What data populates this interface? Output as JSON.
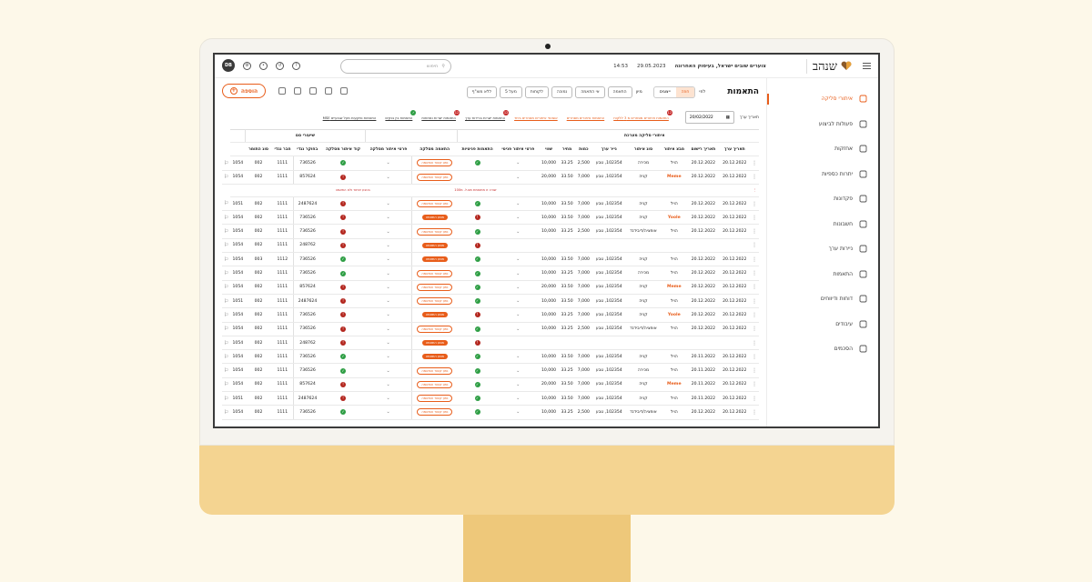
{
  "app": {
    "logo_text": "שנהב",
    "company": "צוערים שובים ישראל, בעיסוק האחרונה",
    "date": "29.05.2023",
    "time": "14:53",
    "search_placeholder": "חיפוש",
    "avatar": "DB"
  },
  "sidebar": [
    {
      "label": "איתורי סליקה",
      "active": true,
      "icon": "receipt-icon"
    },
    {
      "label": "פעולות לביצוע",
      "icon": "tasks-icon"
    },
    {
      "label": "אחזקות",
      "icon": "holdings-icon"
    },
    {
      "label": "יתרות כספיות",
      "icon": "scale-icon"
    },
    {
      "label": "פקדונות",
      "icon": "deposit-icon"
    },
    {
      "label": "חשבונות",
      "icon": "user-icon"
    },
    {
      "label": "ניירות ערך",
      "icon": "star-icon"
    },
    {
      "label": "התאמות",
      "icon": "match-icon"
    },
    {
      "label": "דוחות ודיווחים",
      "icon": "report-icon"
    },
    {
      "label": "עיבודים",
      "icon": "process-icon"
    },
    {
      "label": "הסכמים",
      "icon": "agreement-icon"
    }
  ],
  "page": {
    "title": "התאמות",
    "view_label": "לפי",
    "seg": [
      "חוזה",
      "ייצוגים"
    ],
    "sort_label": "מיון",
    "chips": [
      "התאמה",
      "אי התאמה",
      "נמוכה",
      "לקוחות",
      "מעל 5",
      "ללא מוצ\"ף"
    ],
    "add_label": "הוספה",
    "date_label": "תאריך ערך",
    "date_value": "20/02/2022"
  },
  "filters": [
    {
      "label": "התאמות איתורים מסחרים מ 3 ללקוח",
      "orange": true,
      "badge": "12",
      "badge_color": "red"
    },
    {
      "label": "התאמות איתורים מסחרים",
      "orange": true
    },
    {
      "label": "אשכנזי איתורים מסחרים ביחד",
      "orange": true
    },
    {
      "label": "התאמות ישרות בניירות ערך",
      "badge": "12",
      "badge_color": "red"
    },
    {
      "label": "התאמות ישרות נפתחות",
      "badge": "12",
      "badge_color": "red"
    },
    {
      "label": "התאמות בין בנקים",
      "badge": "✓",
      "badge_color": "green"
    },
    {
      "label": "התאמות נתקעות מעל שבועיים MSE"
    }
  ],
  "table": {
    "group_a": "איתורי סליקה מערכת",
    "group_b": "שיעורי סם",
    "headers": [
      "תאריך ערך",
      "תאריך רישום",
      "מבצ איתור",
      "סוג איתור",
      "נייר ערך",
      "כמות",
      "מחיר",
      "שווי",
      "פרטי איתור פניטי",
      "התאמות פניטיות",
      "התאמה מסלקה",
      "פרטי איתור מסלקה",
      "קוד איתור מסלקה",
      "בחוקר נגדי",
      "חבר נגדי",
      "סוג התומר"
    ],
    "rows": [
      {
        "d1": "20.12.2022",
        "d2": "20.12.2022",
        "src": "הויל",
        "type": "מכירה",
        "sec": "102354, טבע",
        "qty": "2,500",
        "price": "33.25",
        "val": "10,000",
        "s1": "ok",
        "s2": "ok",
        "tag": "נתון קשור והתאמה",
        "tagt": "out",
        "code": "736526",
        "c1": "1111",
        "c2": "002",
        "c3": "1054"
      },
      {
        "d1": "20.12.2022",
        "d2": "20.12.2022",
        "src": "Meme",
        "type": "קניה",
        "sec": "102354, טבע",
        "qty": "7,000",
        "price": "33.50",
        "val": "20,000",
        "s1": "",
        "s2": "bad",
        "tag": "נתון קשור והתאמה",
        "tagt": "out",
        "code": "857624",
        "c1": "1111",
        "c2": "002",
        "c3": "1054"
      },
      {
        "err": "שורה זו מתואמת מס.ל. מ100",
        "err2": "בטבע איתור ולא התאמה"
      },
      {
        "d1": "20.12.2022",
        "d2": "20.12.2022",
        "src": "הויל",
        "type": "קניה",
        "sec": "102354, טבע",
        "qty": "7,000",
        "price": "33.50",
        "val": "10,000",
        "s1": "ok",
        "s2": "bad",
        "tag": "נתון קשור והתאמה",
        "tagt": "out",
        "code": "2487624",
        "c1": "1111",
        "c2": "002",
        "c3": "1051"
      },
      {
        "d1": "20.12.2022",
        "d2": "20.12.2022",
        "src": "Yoole",
        "type": "קניה",
        "sec": "102354, טבע",
        "qty": "7,000",
        "price": "33.50",
        "val": "10,000",
        "s1": "bad",
        "s2": "bad",
        "tag": "מנוע התאמה",
        "tagt": "fill",
        "code": "736526",
        "c1": "1111",
        "c2": "002",
        "c3": "1054"
      },
      {
        "d1": "20.12.2022",
        "d2": "20.12.2022",
        "src": "הויל",
        "type": "אופציה/דיבידנד",
        "sec": "102354, טבע",
        "qty": "2,500",
        "price": "33.25",
        "val": "10,000",
        "s1": "ok",
        "s2": "bad",
        "tag": "נתון קשור והתאמה",
        "tagt": "out",
        "code": "736526",
        "c1": "1111",
        "c2": "002",
        "c3": "1054"
      },
      {
        "d1": "",
        "d2": "",
        "src": "",
        "type": "",
        "sec": "",
        "qty": "",
        "price": "",
        "val": "",
        "s1": "bad",
        "s2": "bad",
        "tag": "מנוע התאמה",
        "tagt": "fill",
        "code": "248762",
        "c1": "1111",
        "c2": "002",
        "c3": "1054"
      },
      {
        "d1": "20.12.2022",
        "d2": "20.12.2022",
        "src": "הויל",
        "type": "קניה",
        "sec": "102354, טבע",
        "qty": "7,000",
        "price": "33.50",
        "val": "10,000",
        "s1": "ok",
        "s2": "ok",
        "tag": "מנוע התאמה",
        "tagt": "fill",
        "code": "736526",
        "c1": "1112",
        "c2": "003",
        "c3": "1054"
      },
      {
        "d1": "20.12.2022",
        "d2": "20.12.2022",
        "src": "הויל",
        "type": "מכירה",
        "sec": "102354, טבע",
        "qty": "7,000",
        "price": "33.25",
        "val": "10,000",
        "s1": "ok",
        "s2": "ok",
        "tag": "נתון קשור והתאמה",
        "tagt": "out",
        "code": "736526",
        "c1": "1111",
        "c2": "002",
        "c3": "1054"
      },
      {
        "d1": "20.12.2022",
        "d2": "20.12.2022",
        "src": "Meme",
        "type": "קניה",
        "sec": "102354, טבע",
        "qty": "7,000",
        "price": "33.50",
        "val": "20,000",
        "s1": "ok",
        "s2": "bad",
        "tag": "נתון קשור והתאמה",
        "tagt": "out",
        "code": "857624",
        "c1": "1111",
        "c2": "002",
        "c3": "1054"
      },
      {
        "d1": "20.12.2022",
        "d2": "20.12.2022",
        "src": "הויל",
        "type": "קניה",
        "sec": "102354, טבע",
        "qty": "7,000",
        "price": "33.50",
        "val": "10,000",
        "s1": "ok",
        "s2": "bad",
        "tag": "נתון קשור והתאמה",
        "tagt": "out",
        "code": "2487624",
        "c1": "1111",
        "c2": "002",
        "c3": "1051"
      },
      {
        "d1": "20.12.2022",
        "d2": "20.12.2022",
        "src": "Yoole",
        "type": "קניה",
        "sec": "102354, טבע",
        "qty": "7,000",
        "price": "33.25",
        "val": "10,000",
        "s1": "bad",
        "s2": "bad",
        "tag": "מנוע התאמה",
        "tagt": "fill",
        "code": "736526",
        "c1": "1111",
        "c2": "002",
        "c3": "1054"
      },
      {
        "d1": "20.12.2022",
        "d2": "20.12.2022",
        "src": "הויל",
        "type": "אופציה/דיבידנד",
        "sec": "102354, טבע",
        "qty": "2,500",
        "price": "33.25",
        "val": "10,000",
        "s1": "ok",
        "s2": "bad",
        "tag": "נתון קשור והתאמה",
        "tagt": "out",
        "code": "736526",
        "c1": "1111",
        "c2": "002",
        "c3": "1054"
      },
      {
        "d1": "",
        "d2": "",
        "src": "",
        "type": "",
        "sec": "",
        "qty": "",
        "price": "",
        "val": "",
        "s1": "bad",
        "s2": "bad",
        "tag": "מנוע התאמה",
        "tagt": "fill",
        "code": "248762",
        "c1": "1111",
        "c2": "002",
        "c3": "1054"
      },
      {
        "d1": "20.12.2022",
        "d2": "20.11.2022",
        "src": "הויל",
        "type": "קניה",
        "sec": "102354, טבע",
        "qty": "7,000",
        "price": "33.50",
        "val": "10,000",
        "s1": "ok",
        "s2": "ok",
        "tag": "מנוע התאמה",
        "tagt": "fill",
        "code": "736526",
        "c1": "1111",
        "c2": "002",
        "c3": "1054"
      },
      {
        "d1": "20.12.2022",
        "d2": "20.11.2022",
        "src": "הויל",
        "type": "מכירה",
        "sec": "102354, טבע",
        "qty": "7,000",
        "price": "33.25",
        "val": "10,000",
        "s1": "ok",
        "s2": "ok",
        "tag": "נתון קשור והתאמה",
        "tagt": "out",
        "code": "736526",
        "c1": "1111",
        "c2": "002",
        "c3": "1054"
      },
      {
        "d1": "20.12.2022",
        "d2": "20.11.2022",
        "src": "Meme",
        "type": "קניה",
        "sec": "102354, טבע",
        "qty": "7,000",
        "price": "33.50",
        "val": "20,000",
        "s1": "ok",
        "s2": "bad",
        "tag": "נתון קשור והתאמה",
        "tagt": "out",
        "code": "857624",
        "c1": "1111",
        "c2": "002",
        "c3": "1054"
      },
      {
        "d1": "20.12.2022",
        "d2": "20.11.2022",
        "src": "הויל",
        "type": "קניה",
        "sec": "102354, טבע",
        "qty": "7,000",
        "price": "33.50",
        "val": "10,000",
        "s1": "ok",
        "s2": "bad",
        "tag": "נתון קשור והתאמה",
        "tagt": "out",
        "code": "2487624",
        "c1": "1111",
        "c2": "002",
        "c3": "1051"
      },
      {
        "d1": "20.12.2022",
        "d2": "20.12.2022",
        "src": "הויל",
        "type": "אופציה/דיבידנד",
        "sec": "102354, טבע",
        "qty": "2,500",
        "price": "33.25",
        "val": "10,000",
        "s1": "ok",
        "s2": "ok",
        "tag": "נתון קשור והתאמה",
        "tagt": "out",
        "code": "736526",
        "c1": "1111",
        "c2": "002",
        "c3": "1054"
      }
    ]
  },
  "colors": {
    "accent": "#e85d1a",
    "ok": "#2e9e44",
    "bad": "#b3261e"
  }
}
